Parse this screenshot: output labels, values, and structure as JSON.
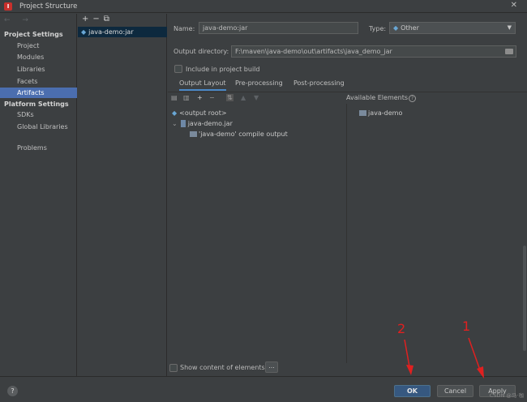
{
  "window": {
    "title": "Project Structure",
    "close_glyph": "✕"
  },
  "sidebar": {
    "nav_arrows": "← →",
    "sections": [
      {
        "header": "Project Settings",
        "items": [
          "Project",
          "Modules",
          "Libraries",
          "Facets",
          "Artifacts"
        ]
      },
      {
        "header": "Platform Settings",
        "items": [
          "SDKs",
          "Global Libraries"
        ]
      }
    ],
    "selected": "Artifacts",
    "problems": "Problems"
  },
  "artifact_list": {
    "toolbar": [
      "+",
      "−",
      "⧉"
    ],
    "items": [
      "java-demo:jar"
    ]
  },
  "detail": {
    "name_label": "Name:",
    "name_value": "java-demo:jar",
    "type_label": "Type:",
    "type_value": "Other",
    "output_label": "Output directory:",
    "output_value": "F:\\maven\\java-demo\\out\\artifacts\\java_demo_jar",
    "include_label": "Include in project build",
    "tabs": [
      "Output Layout",
      "Pre-processing",
      "Post-processing"
    ],
    "active_tab": "Output Layout",
    "layout_tree": [
      {
        "label": "<output root>",
        "level": 0,
        "expanded": false
      },
      {
        "label": "java-demo.jar",
        "level": 0,
        "expanded": true
      },
      {
        "label": "'java-demo' compile output",
        "level": 1,
        "expanded": false
      }
    ],
    "available_header": "Available Elements",
    "available_items": [
      "java-demo"
    ],
    "show_content_label": "Show content of elements",
    "ellipsis": "..."
  },
  "buttons": {
    "help": "?",
    "ok": "OK",
    "cancel": "Cancel",
    "apply": "Apply"
  },
  "annotations": {
    "one": "1",
    "two": "2"
  },
  "watermark": "CSDN @马·咖",
  "colors": {
    "selection": "#4b6eaf",
    "primary_button": "#365880",
    "annotation": "#e02020"
  }
}
